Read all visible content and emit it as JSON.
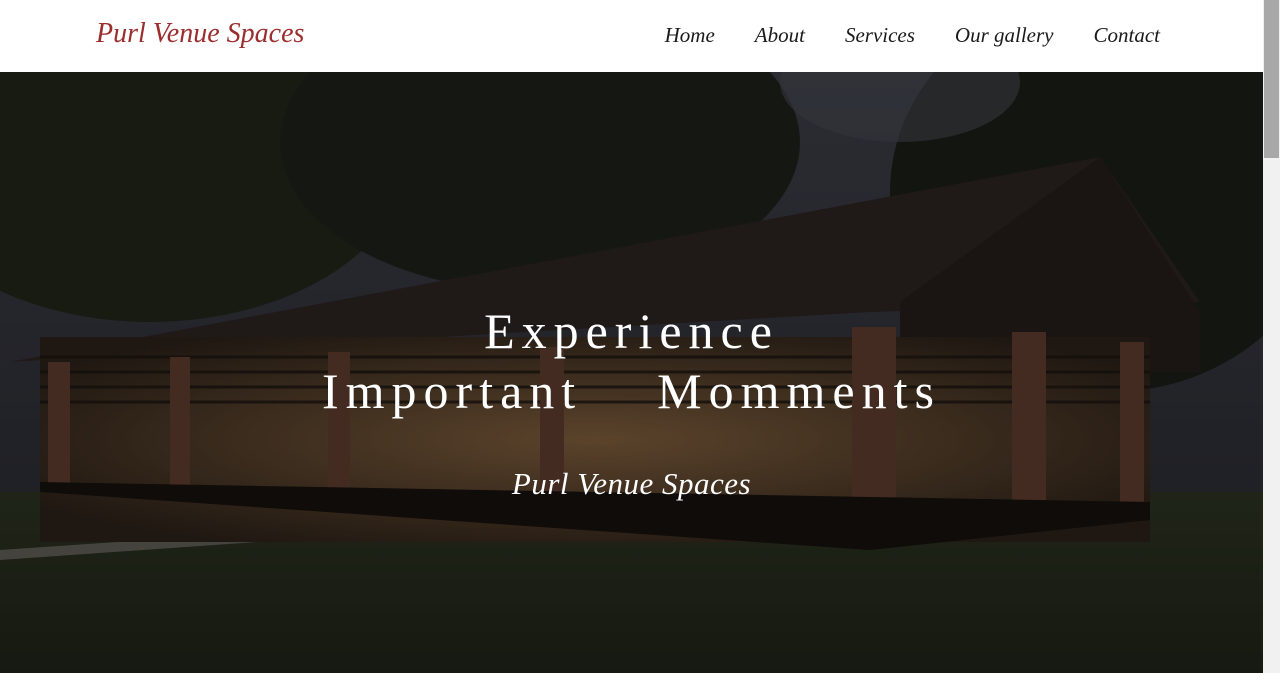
{
  "header": {
    "brand": "Purl Venue Spaces",
    "nav": [
      {
        "label": "Home"
      },
      {
        "label": "About"
      },
      {
        "label": "Services"
      },
      {
        "label": "Our gallery"
      },
      {
        "label": "Contact"
      }
    ]
  },
  "hero": {
    "heading_line1": "Experience",
    "heading_line2": "Important  Momments",
    "subtitle": "Purl Venue Spaces",
    "background_image": "dusk outdoor pavilion venue with string lights and guests"
  },
  "colors": {
    "brand": "#9b2d2d",
    "nav_text": "#1a1a1a",
    "hero_text": "#ffffff",
    "header_bg": "#ffffff"
  }
}
